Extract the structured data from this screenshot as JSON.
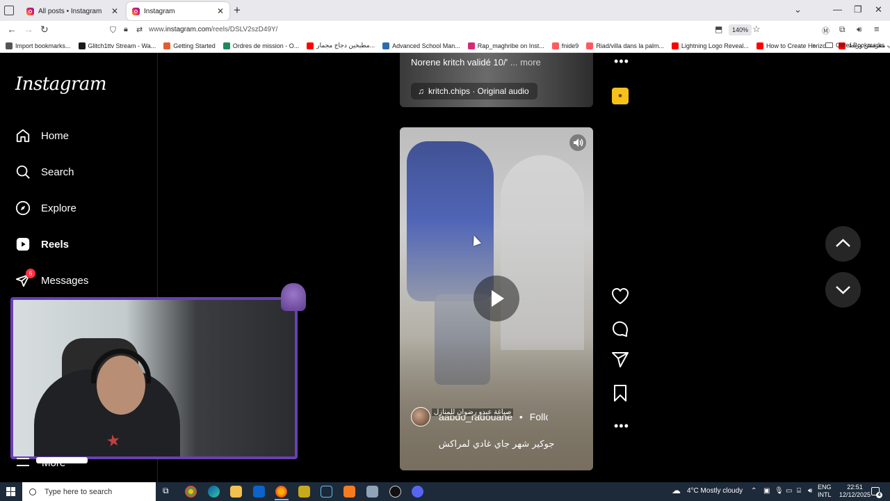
{
  "browser": {
    "tabs": [
      {
        "label": "All posts • Instagram",
        "active": false
      },
      {
        "label": "Instagram",
        "active": true
      }
    ],
    "url_prefix": "www.",
    "url_host": "instagram.com",
    "url_path": "/reels/DSLV2szD49Y/",
    "zoom": "140%",
    "bookmarks": [
      {
        "label": "Import bookmarks...",
        "icon": "import-icon",
        "color": "#555555"
      },
      {
        "label": "Glitch1ttv Stream - Wa...",
        "icon": "kick-icon",
        "color": "#1a1a1a"
      },
      {
        "label": "Getting Started",
        "icon": "firefox-icon",
        "color": "#e55b2d"
      },
      {
        "label": "Ordres de mission - O...",
        "icon": "sheet-icon",
        "color": "#1f8a5b"
      },
      {
        "label": "مطبخين دجاج مجمار...",
        "icon": "youtube-icon",
        "color": "#ff0000"
      },
      {
        "label": "Advanced School Man...",
        "icon": "shield-icon",
        "color": "#2b6cb0"
      },
      {
        "label": "Rap_maghribe on Inst...",
        "icon": "instagram-icon",
        "color": "#d62976"
      },
      {
        "label": "fnide9",
        "icon": "airbnb-icon",
        "color": "#ff5a5f"
      },
      {
        "label": "Riad/villa dans la palm...",
        "icon": "airbnb-icon",
        "color": "#ff5a5f"
      },
      {
        "label": "Lightning Logo Reveal...",
        "icon": "youtube-icon",
        "color": "#ff0000"
      },
      {
        "label": "How to Create Horizo...",
        "icon": "youtube-icon",
        "color": "#ff0000"
      },
      {
        "label": "عون حليب مقرمش وربط...",
        "icon": "youtube-icon",
        "color": "#ff0000"
      }
    ],
    "other_bookmarks": "Other Bookmarks"
  },
  "sidebar": {
    "logo": "Instagram",
    "items": [
      {
        "label": "Home",
        "icon": "home-icon"
      },
      {
        "label": "Search",
        "icon": "search-icon"
      },
      {
        "label": "Explore",
        "icon": "explore-icon"
      },
      {
        "label": "Reels",
        "icon": "reels-icon",
        "active": true
      },
      {
        "label": "Messages",
        "icon": "messages-icon",
        "badge": "6"
      }
    ],
    "more_label": "More"
  },
  "previous_reel": {
    "caption": "Norene kritch validé 10/'",
    "more": "... more",
    "audio": "kritch.chips · Original audio"
  },
  "reel": {
    "username": "aabdo_radouane",
    "follow": "Follow",
    "overlay_text": "صياغة عبدو رضوان للمنازل",
    "caption": "جوكير شهر جاي غادي لمراكش"
  },
  "taskbar": {
    "search_placeholder": "Type here to search",
    "weather": "4°C  Mostly cloudy",
    "lang1": "ENG",
    "lang2": "INTL",
    "time": "22:51",
    "date": "12/12/2025",
    "notifications": "4"
  },
  "colors": {
    "accent_purple": "#6a3fb5",
    "badge_red": "#ff3040",
    "taskbar": "#1c2a3a"
  }
}
